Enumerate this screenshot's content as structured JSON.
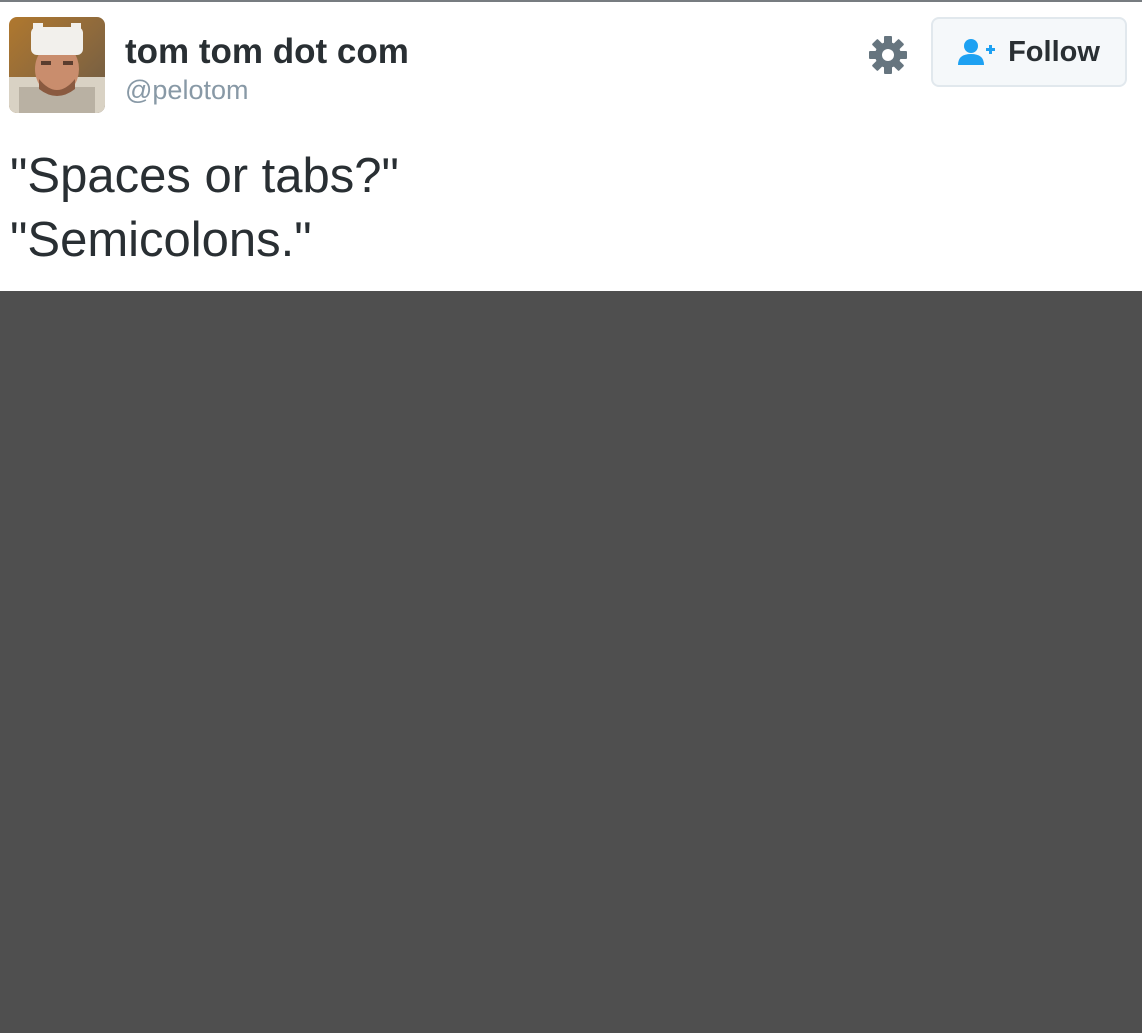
{
  "user": {
    "display_name": "tom tom dot com",
    "handle": "@pelotom",
    "avatar": "profile-photo"
  },
  "actions": {
    "settings_icon": "gear-icon",
    "follow_label": "Follow",
    "follow_icon": "add-user-icon"
  },
  "tweet": {
    "lines": [
      "\"Spaces or tabs?\"",
      "\"Semicolons.\""
    ]
  },
  "colors": {
    "name": "#292f33",
    "handle": "#8899a6",
    "follow_icon": "#1da1f2",
    "button_bg": "#f5f8fa",
    "button_border": "#e1e8ed",
    "gear": "#66757f",
    "media_bg": "#4f4f4f"
  }
}
